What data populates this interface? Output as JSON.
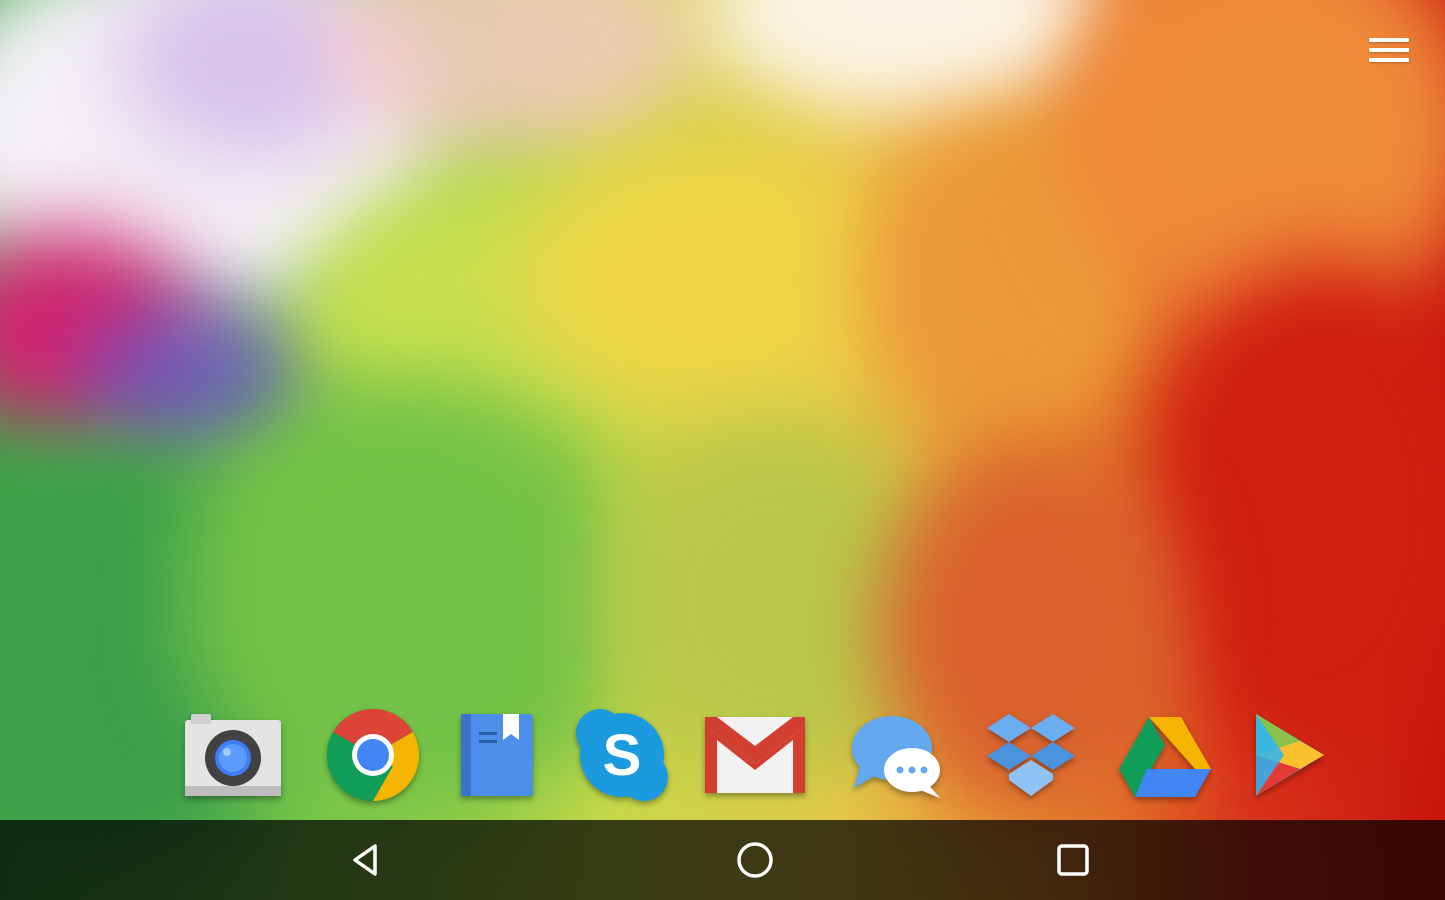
{
  "screen": {
    "type": "android-tablet-home-screen",
    "wallpaper": "colorful-smoke-wallpaper",
    "colors": {
      "navbar_bg": "#000000",
      "icon_white": "#ffffff",
      "chrome_red": "#db4437",
      "chrome_green": "#0f9d58",
      "chrome_yellow": "#f4b400",
      "chrome_blue": "#4285f4",
      "skype_blue": "#00aff0",
      "dropbox_blue": "#5fa6e8"
    }
  },
  "top_bar": {
    "menu_icon": "hamburger-menu-icon"
  },
  "dock": {
    "apps": [
      {
        "icon": "camera-icon"
      },
      {
        "icon": "chrome-icon"
      },
      {
        "icon": "play-books-icon"
      },
      {
        "icon": "skype-icon",
        "glyph": "S"
      },
      {
        "icon": "gmail-icon"
      },
      {
        "icon": "messenger-icon"
      },
      {
        "icon": "dropbox-icon"
      },
      {
        "icon": "google-drive-icon"
      },
      {
        "icon": "play-store-icon"
      }
    ]
  },
  "nav_bar": {
    "buttons": [
      {
        "icon": "back-icon"
      },
      {
        "icon": "home-icon"
      },
      {
        "icon": "recents-icon"
      }
    ]
  }
}
